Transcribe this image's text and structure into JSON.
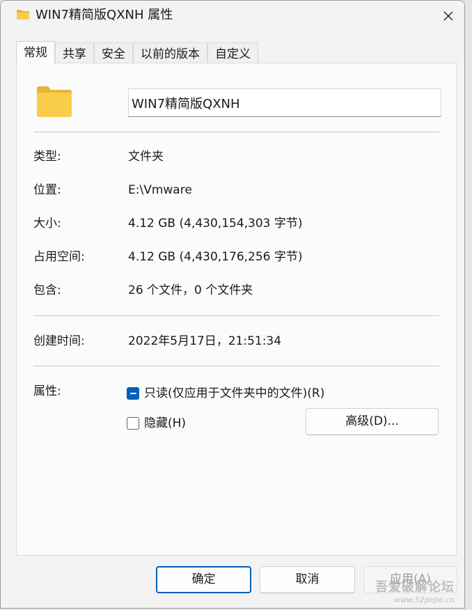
{
  "window": {
    "title": "WIN7精简版QXNH 属性",
    "icon": "folder-icon",
    "close_icon": "close-icon"
  },
  "tabs": [
    {
      "label": "常规",
      "active": true
    },
    {
      "label": "共享",
      "active": false
    },
    {
      "label": "安全",
      "active": false
    },
    {
      "label": "以前的版本",
      "active": false
    },
    {
      "label": "自定义",
      "active": false
    }
  ],
  "general": {
    "name_value": "WIN7精简版QXNH",
    "type_label": "类型:",
    "type_value": "文件夹",
    "location_label": "位置:",
    "location_value": "E:\\Vmware",
    "size_label": "大小:",
    "size_value": "4.12 GB (4,430,154,303 字节)",
    "size_on_disk_label": "占用空间:",
    "size_on_disk_value": "4.12 GB (4,430,176,256 字节)",
    "contains_label": "包含:",
    "contains_value": "26 个文件，0 个文件夹",
    "created_label": "创建时间:",
    "created_value": "2022年5月17日，21:51:34",
    "attributes_label": "属性:",
    "readonly_label": "只读(仅应用于文件夹中的文件)(R)",
    "readonly_state": "indeterminate",
    "hidden_label": "隐藏(H)",
    "hidden_state": "unchecked",
    "advanced_button": "高级(D)..."
  },
  "footer": {
    "ok_label": "确定",
    "cancel_label": "取消",
    "apply_label": "应用(A)"
  },
  "watermark": {
    "text": "吾爱破解论坛",
    "url": "www.52pojie.cn"
  },
  "colors": {
    "accent": "#005fb8",
    "folder_yellow": "#f8cd4a",
    "window_bg": "#f3f3f3",
    "panel_bg": "#fbfbfb"
  }
}
